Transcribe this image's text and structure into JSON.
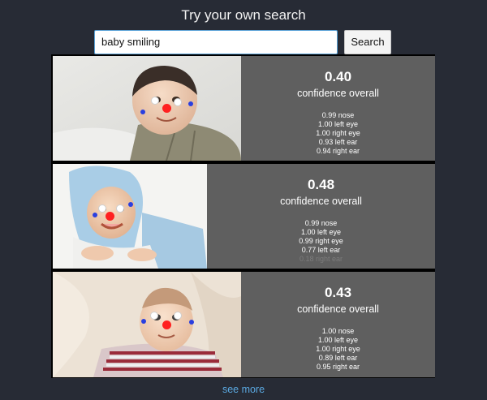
{
  "header": {
    "title": "Try your own search"
  },
  "search": {
    "value": "baby smiling",
    "button_label": "Search"
  },
  "results": [
    {
      "score": "0.40",
      "score_label": "confidence overall",
      "keypoints": [
        {
          "label": "0.99 nose",
          "confidence": 0.99
        },
        {
          "label": "1.00 left eye",
          "confidence": 1.0
        },
        {
          "label": "1.00 right eye",
          "confidence": 1.0
        },
        {
          "label": "0.93 left ear",
          "confidence": 0.93
        },
        {
          "label": "0.94 right ear",
          "confidence": 0.94
        }
      ]
    },
    {
      "score": "0.48",
      "score_label": "confidence overall",
      "keypoints": [
        {
          "label": "0.99 nose",
          "confidence": 0.99
        },
        {
          "label": "1.00 left eye",
          "confidence": 1.0
        },
        {
          "label": "0.99 right eye",
          "confidence": 0.99
        },
        {
          "label": "0.77 left ear",
          "confidence": 0.77
        },
        {
          "label": "0.18 right ear",
          "confidence": 0.18
        }
      ]
    },
    {
      "score": "0.43",
      "score_label": "confidence overall",
      "keypoints": [
        {
          "label": "1.00 nose",
          "confidence": 1.0
        },
        {
          "label": "1.00 left eye",
          "confidence": 1.0
        },
        {
          "label": "1.00 right eye",
          "confidence": 1.0
        },
        {
          "label": "0.89 left ear",
          "confidence": 0.89
        },
        {
          "label": "0.95 right ear",
          "confidence": 0.95
        }
      ]
    }
  ],
  "footer": {
    "see_more_label": "see more"
  },
  "colors": {
    "background": "#272b35",
    "card": "#5f5f5f",
    "link": "#5aa8e0",
    "nose_marker": "#ff2020",
    "eye_marker": "#ffffff",
    "ear_marker": "#2a3fe0"
  }
}
